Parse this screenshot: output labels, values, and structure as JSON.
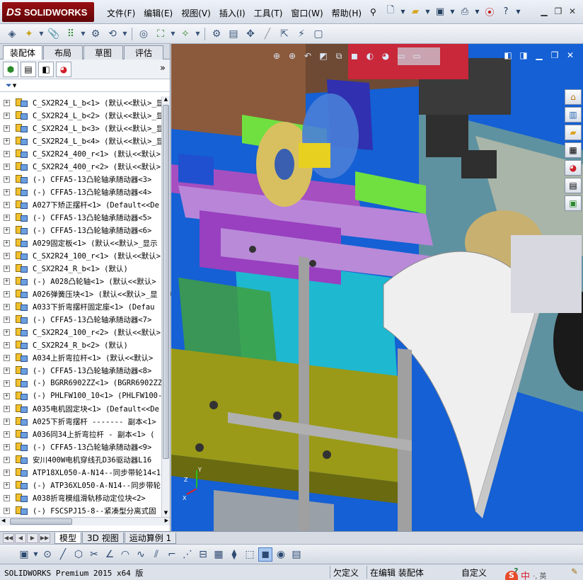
{
  "app": {
    "logo_ds": "DS",
    "logo_text": "SOLIDWORKS"
  },
  "menu": [
    "文件(F)",
    "编辑(E)",
    "视图(V)",
    "插入(I)",
    "工具(T)",
    "窗口(W)",
    "帮助(H)"
  ],
  "command_manager_tabs": [
    "装配体",
    "布局",
    "草图",
    "评估"
  ],
  "command_manager_active": "装配体",
  "feature_tree": [
    {
      "label": "C_SX2R24_L_b<1> (默认<<默认>_显"
    },
    {
      "label": "C_SX2R24_L_b<2> (默认<<默认>_显"
    },
    {
      "label": "C_SX2R24_L_b<3> (默认<<默认>_显"
    },
    {
      "label": "C_SX2R24_L_b<4> (默认<<默认>_显"
    },
    {
      "label": "C_SX2R24_400_r<1> (默认<<默认>"
    },
    {
      "label": "C_SX2R24_400_r<2> (默认<<默认>"
    },
    {
      "label": "(-) CFFA5-13凸轮轴承随动器<3>"
    },
    {
      "label": "(-) CFFA5-13凸轮轴承随动器<4>"
    },
    {
      "label": "A027下矫正摆杆<1> (Default<<De"
    },
    {
      "label": "(-) CFFA5-13凸轮轴承随动器<5>"
    },
    {
      "label": "(-) CFFA5-13凸轮轴承随动器<6>"
    },
    {
      "label": "A029固定板<1> (默认<<默认>_显示"
    },
    {
      "label": "C_SX2R24_100_r<1> (默认<<默认>"
    },
    {
      "label": "C_SX2R24_R_b<1> (默认)"
    },
    {
      "label": "(-) A028凸轮轴<1> (默认<<默认>"
    },
    {
      "label": "A026弹簧压块<1> (默认<<默认>_显"
    },
    {
      "label": "A033下折弯摆杆固定座<1> (Defau"
    },
    {
      "label": "(-) CFFA5-13凸轮轴承随动器<7>"
    },
    {
      "label": "C_SX2R24_100_r<2> (默认<<默认>"
    },
    {
      "label": "C_SX2R24_R_b<2> (默认)"
    },
    {
      "label": "A034上折弯拉杆<1> (默认<<默认>"
    },
    {
      "label": "(-) CFFA5-13凸轮轴承随动器<8>"
    },
    {
      "label": "(-) BGRR6902ZZ<1> (BGRR6902ZZ)"
    },
    {
      "label": "(-) PHLFW100_10<1> (PHLFW100-1"
    },
    {
      "label": "A035电机固定块<1> (Default<<De"
    },
    {
      "label": "A025下折弯摆杆 ------- 副本<1>"
    },
    {
      "label": "A036同34上折弯拉杆 - 副本<1> ("
    },
    {
      "label": "(-) CFFA5-13凸轮轴承随动器<9>"
    },
    {
      "label": "安川400W电机穿线孔D36驱动器L16"
    },
    {
      "label": "ATP18XL050-A-N14--同步带轮14<1"
    },
    {
      "label": "(-) ATP36XL050-A-N14--同步带轮"
    },
    {
      "label": "A038折弯模组滑轨移动定位块<2>"
    },
    {
      "label": "(-) FSCSPJ15-8--紧凑型分离式固"
    }
  ],
  "bottom_tabs": [
    "模型",
    "3D 视图",
    "运动算例 1"
  ],
  "bottom_tab_active": "模型",
  "status": {
    "product": "SOLIDWORKS Premium 2015 x64 版",
    "undefined": "欠定义",
    "editing": "在编辑 装配体",
    "custom": "自定义"
  },
  "ime": {
    "label": "中",
    "extra": "·, 英"
  },
  "colors": {
    "viewport_bg": "#1460d4",
    "logo_red": "#8c0d10"
  }
}
